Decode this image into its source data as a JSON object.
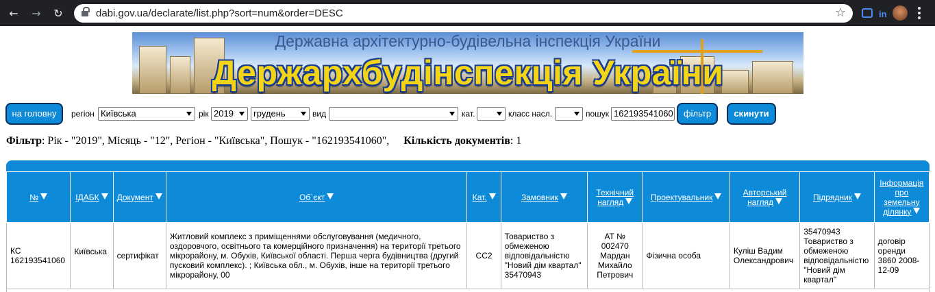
{
  "browser": {
    "url": "dabi.gov.ua/declarate/list.php?sort=num&order=DESC",
    "back_icon": "arrow-left-icon",
    "forward_icon": "arrow-right-icon",
    "reload_icon": "reload-icon",
    "star_icon": "star-icon",
    "menu_icon": "kebab-menu-icon",
    "extension_text": "in"
  },
  "banner": {
    "subtitle": "Державна архітектурно-будівельна інспекція України",
    "title": "Держархбудінспекція України"
  },
  "filters": {
    "home_button": "на головну",
    "region_label": "регіон",
    "region_value": "Київська",
    "year_label": "рік",
    "year_value": "2019",
    "month_value": "грудень",
    "type_label": "вид",
    "type_value": "",
    "category_label": "кат.",
    "category_value": "",
    "class_label": "класс насл.",
    "class_value": "",
    "search_label": "пошук",
    "search_value": "162193541060",
    "filter_button": "фільтр",
    "reset_button": "скинути"
  },
  "summary": {
    "filter_label": "Фільтр",
    "filter_text": ": Рік - \"2019\", Місяць - \"12\", Регіон - \"Київська\", Пошук - \"162193541060\",",
    "count_label": "Кількість документів",
    "count_text": ": 1"
  },
  "table": {
    "headers": [
      "№",
      "ІДАБК",
      "Документ",
      "Об`єкт",
      "Кат.",
      "Замовник",
      "Технічний нагляд",
      "Проектувальник",
      "Авторський нагляд",
      "Підрядник",
      "Інформація про земельну ділянку"
    ],
    "rows": [
      [
        "КС 162193541060",
        "Київська",
        "сертифікат",
        "Житловий комплекс з приміщеннями обслуговування (медичного, оздоровчого, освітнього та комерційного призначення) на території третього мікрорайону, м. Обухів, Київської області. Перша черга будівництва (другий пусковий комплекс). ; Київська обл., м. Обухів, інше на території третього мікрорайону, 00",
        "СС2",
        "Товариство з обмеженою відповідальністю \"Новий дім квартал\" 35470943",
        "АТ № 002470 Мардан Михайло Петрович",
        "Фізична особа",
        "Куліш Вадим Олександрович",
        "35470943 Товариство з обмеженою відповідальністю \"Новий дім квартал\"",
        "договір оренди 3860 2008-12-09"
      ]
    ]
  },
  "colors": {
    "accent": "#0e8bd8",
    "button_border": "#0a2c55",
    "banner_title": "#f3d417",
    "chrome": "#202124"
  }
}
